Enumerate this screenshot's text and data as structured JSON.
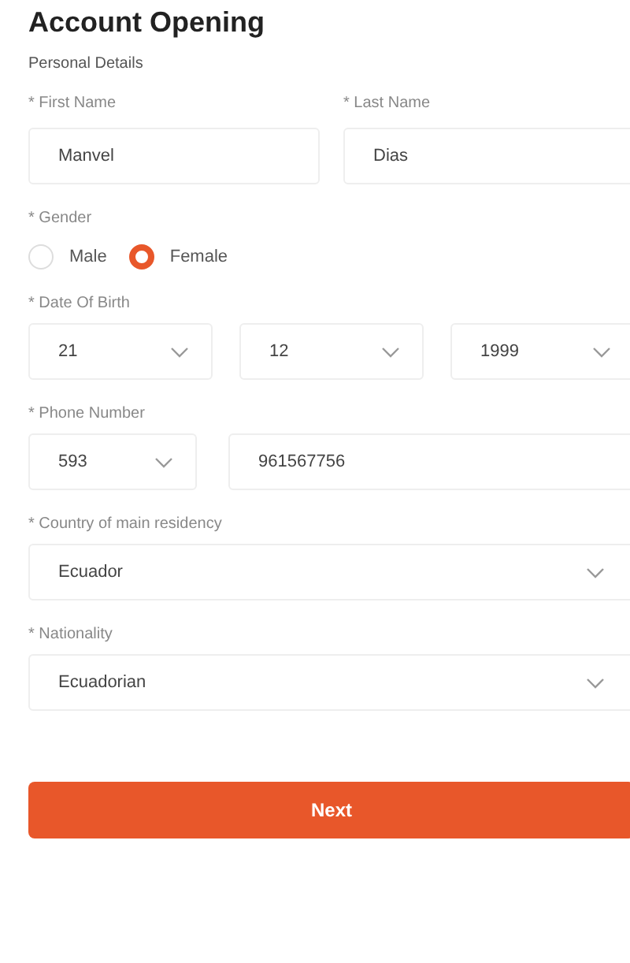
{
  "title": "Account Opening",
  "subtitle": "Personal Details",
  "name_fields": [
    {
      "label": "* First Name",
      "value": "Manvel"
    },
    {
      "label": "* Last Name",
      "value": "Dias"
    }
  ],
  "gender": {
    "label": "* Gender",
    "options": [
      {
        "label": "Male",
        "selected": false
      },
      {
        "label": "Female",
        "selected": true
      }
    ]
  },
  "date_of_birth": {
    "label": "* Date Of Birth",
    "selects": [
      "21",
      "12",
      "1999"
    ]
  },
  "phone": {
    "label": "* Phone Number",
    "code": "593",
    "number": "961567756"
  },
  "country": {
    "label": "* Country of main residency",
    "value": "Ecuador"
  },
  "nationality": {
    "label": "* Nationality",
    "value": "Ecuadorian"
  },
  "button": "Next"
}
